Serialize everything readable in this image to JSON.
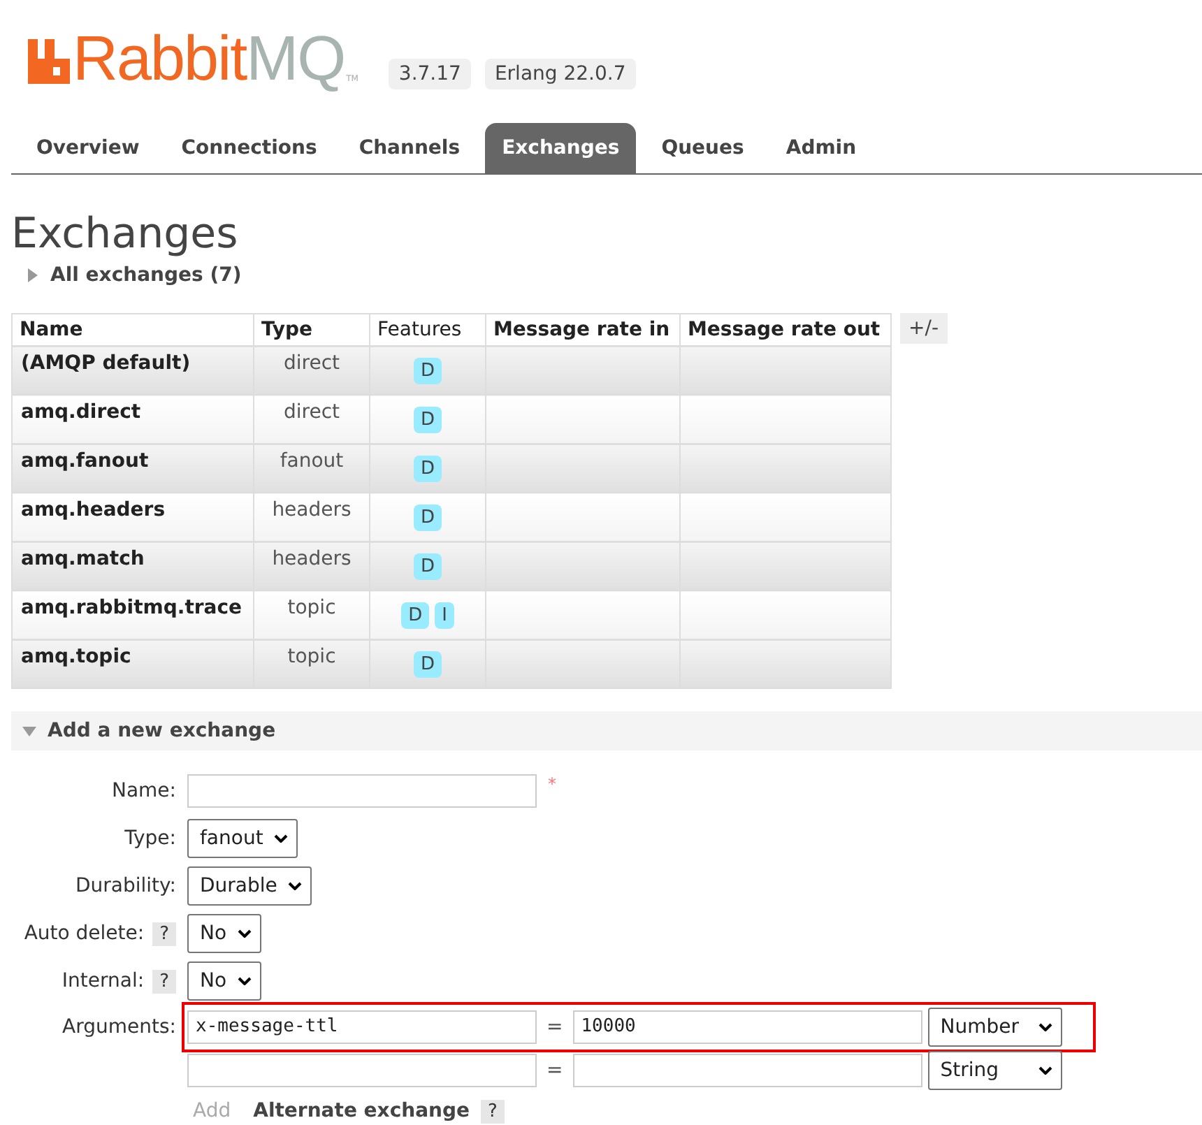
{
  "header": {
    "logo": {
      "first": "Rabbit",
      "second": "MQ",
      "mark": "TM"
    },
    "badges": [
      "3.7.17",
      "Erlang 22.0.7"
    ]
  },
  "tabs": [
    {
      "label": "Overview",
      "selected": false
    },
    {
      "label": "Connections",
      "selected": false
    },
    {
      "label": "Channels",
      "selected": false
    },
    {
      "label": "Exchanges",
      "selected": true
    },
    {
      "label": "Queues",
      "selected": false
    },
    {
      "label": "Admin",
      "selected": false
    }
  ],
  "page_title": "Exchanges",
  "all_exchanges": {
    "label": "All exchanges (7)",
    "expanded": false
  },
  "table": {
    "columns": [
      {
        "label": "Name",
        "bold": true
      },
      {
        "label": "Type",
        "bold": true
      },
      {
        "label": "Features",
        "bold": false
      },
      {
        "label": "Message rate in",
        "bold": true
      },
      {
        "label": "Message rate out",
        "bold": true
      }
    ],
    "toggle": "+/-",
    "rows": [
      {
        "name": "(AMQP default)",
        "type": "direct",
        "features": [
          "D"
        ]
      },
      {
        "name": "amq.direct",
        "type": "direct",
        "features": [
          "D"
        ]
      },
      {
        "name": "amq.fanout",
        "type": "fanout",
        "features": [
          "D"
        ]
      },
      {
        "name": "amq.headers",
        "type": "headers",
        "features": [
          "D"
        ]
      },
      {
        "name": "amq.match",
        "type": "headers",
        "features": [
          "D"
        ]
      },
      {
        "name": "amq.rabbitmq.trace",
        "type": "topic",
        "features": [
          "D",
          "I"
        ]
      },
      {
        "name": "amq.topic",
        "type": "topic",
        "features": [
          "D"
        ]
      }
    ]
  },
  "add_exchange": {
    "label": "Add a new exchange",
    "expanded": true,
    "fields": [
      {
        "label": "Name:",
        "kind": "text",
        "help": false,
        "required": "*"
      },
      {
        "label": "Type:",
        "kind": "select",
        "value": "fanout",
        "help": false
      },
      {
        "label": "Durability:",
        "kind": "select",
        "value": "Durable",
        "help": false
      },
      {
        "label": "Auto delete:",
        "kind": "select",
        "value": "No",
        "help": true
      },
      {
        "label": "Internal:",
        "kind": "select",
        "value": "No",
        "help": true
      }
    ],
    "help_mark": "?",
    "arguments": {
      "label": "Arguments:",
      "equals": "=",
      "rows": [
        {
          "key": "x-message-ttl",
          "value": "10000",
          "type": "Number",
          "highlighted": true
        },
        {
          "type": "String",
          "highlighted": false
        }
      ]
    },
    "add_link": "Add",
    "alternate": {
      "label": "Alternate exchange",
      "help": true
    }
  }
}
